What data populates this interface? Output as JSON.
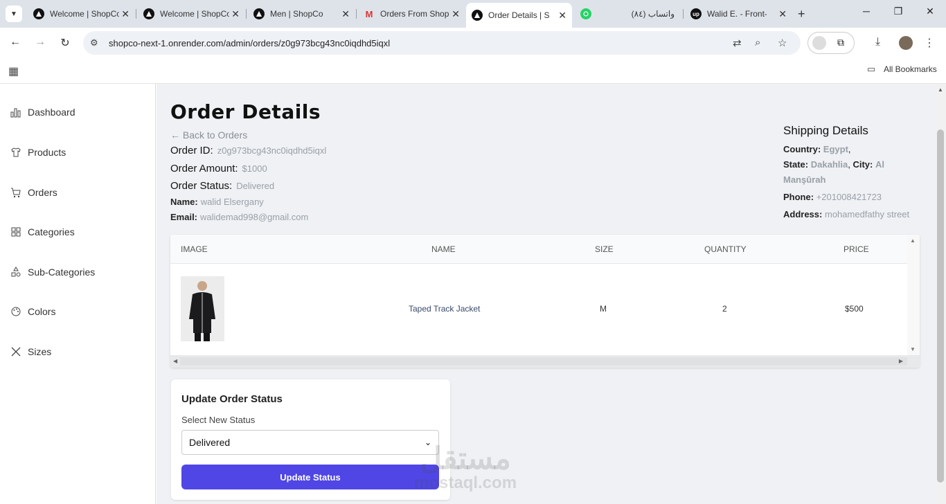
{
  "browser": {
    "tabs": [
      {
        "title": "Welcome | ShopCo",
        "icon": "nextjs-icon"
      },
      {
        "title": "Welcome | ShopCo",
        "icon": "nextjs-icon"
      },
      {
        "title": "Men | ShopCo",
        "icon": "nextjs-icon"
      },
      {
        "title": "Orders From ShopCo",
        "icon": "gmail-icon"
      },
      {
        "title": "Order Details | ShopCo",
        "icon": "nextjs-icon",
        "active": true
      },
      {
        "title": "(٨٤) واتساب",
        "icon": "whatsapp-icon"
      },
      {
        "title": "Walid E. - Front-",
        "icon": "upwork-icon"
      }
    ],
    "url": "shopco-next-1.onrender.com/admin/orders/z0g973bcg43nc0iqdhd5iqxl",
    "bookmarks_label": "All Bookmarks"
  },
  "sidebar": {
    "items": [
      {
        "label": "Dashboard",
        "icon": "bar-chart-icon"
      },
      {
        "label": "Products",
        "icon": "shirt-icon"
      },
      {
        "label": "Orders",
        "icon": "cart-icon"
      },
      {
        "label": "Categories",
        "icon": "grid-icon"
      },
      {
        "label": "Sub-Categories",
        "icon": "shapes-icon"
      },
      {
        "label": "Colors",
        "icon": "palette-icon"
      },
      {
        "label": "Sizes",
        "icon": "x-icon"
      }
    ]
  },
  "order": {
    "title": "Order Details",
    "back_label": "Back to Orders",
    "id_label": "Order ID:",
    "id": "z0g973bcg43nc0iqdhd5iqxl",
    "amount_label": "Order Amount:",
    "amount": "$1000",
    "status_label": "Order Status:",
    "status": "Delivered",
    "name_label": "Name:",
    "name": "walid Elsergany",
    "email_label": "Email:",
    "email": "walidemad998@gmail.com"
  },
  "shipping": {
    "title": "Shipping Details",
    "country_label": "Country:",
    "country": "Egypt",
    "state_label": "State:",
    "state": "Dakahlia",
    "city_label": "City:",
    "city": "Al Manşūrah",
    "phone_label": "Phone:",
    "phone": "+201008421723",
    "address_label": "Address:",
    "address": "mohamedfathy street"
  },
  "items_table": {
    "columns": [
      "IMAGE",
      "NAME",
      "SIZE",
      "QUANTITY",
      "PRICE"
    ],
    "rows": [
      {
        "name": "Taped Track Jacket",
        "size": "M",
        "quantity": "2",
        "price": "$500"
      }
    ]
  },
  "update_status": {
    "title": "Update Order Status",
    "label": "Select New Status",
    "selected": "Delivered",
    "button": "Update Status"
  },
  "watermark": {
    "line1": "مستقل",
    "line2": "mostaql.com"
  },
  "colors": {
    "accent": "#4f46e5",
    "main_bg": "#eff1f4"
  }
}
